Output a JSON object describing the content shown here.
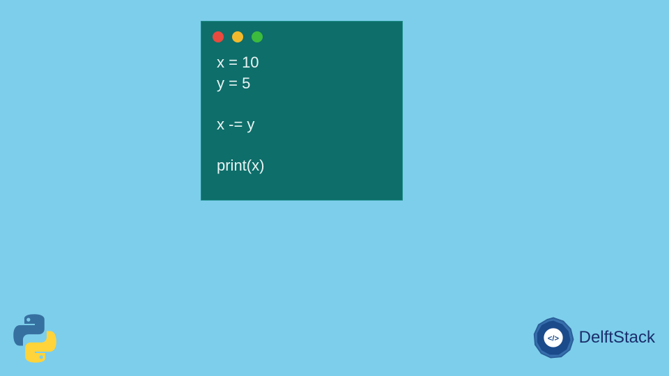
{
  "code": {
    "lines": [
      "x = 10",
      "y = 5",
      "",
      "x -= y",
      "",
      "print(x)"
    ]
  },
  "traffic_lights": {
    "red": "#e84a3f",
    "yellow": "#f3b92c",
    "green": "#3cbb3c"
  },
  "branding": {
    "name": "DelftStack"
  },
  "icons": {
    "python": "python-logo",
    "delftstack": "delftstack-logo"
  }
}
